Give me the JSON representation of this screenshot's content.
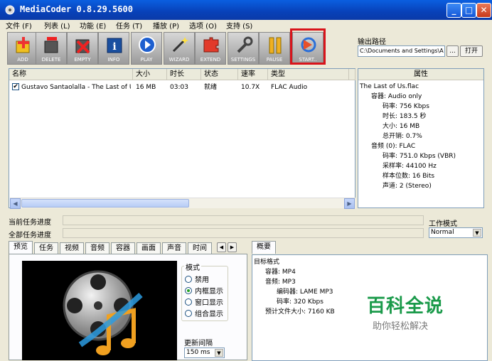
{
  "window": {
    "title": "MediaCoder 0.8.29.5600"
  },
  "menu": [
    {
      "label": "文件 (F)"
    },
    {
      "label": "列表 (L)"
    },
    {
      "label": "功能 (E)"
    },
    {
      "label": "任务 (T)"
    },
    {
      "label": "播放 (P)"
    },
    {
      "label": "选项 (O)"
    },
    {
      "label": "支持 (S)"
    }
  ],
  "toolbar": {
    "buttons": [
      {
        "label": "ADD",
        "icon": "add-icon"
      },
      {
        "label": "DELETE",
        "icon": "delete-icon"
      },
      {
        "label": "EMPTY",
        "icon": "empty-icon"
      },
      {
        "label": "INFO",
        "icon": "info-icon"
      },
      {
        "label": "PLAY",
        "icon": "play-icon"
      },
      {
        "label": "WIZARD",
        "icon": "wizard-icon"
      },
      {
        "label": "EXTEND",
        "icon": "extend-icon"
      },
      {
        "label": "SETTINGS",
        "icon": "settings-icon"
      },
      {
        "label": "PAUSE",
        "icon": "pause-icon"
      },
      {
        "label": "START..",
        "icon": "start-icon"
      }
    ],
    "highlight_color": "#d8141b"
  },
  "output": {
    "label": "输出路径",
    "path": "C:\\Documents and Settings\\A",
    "browse_label": "...",
    "open_label": "打开"
  },
  "file_list": {
    "columns": [
      "名称",
      "大小",
      "时长",
      "状态",
      "速率",
      "类型"
    ],
    "rows": [
      {
        "checked": true,
        "name": "Gustavo Santaolalla - The Last of Us",
        "size": "16 MB",
        "duration": "03:03",
        "status": "就绪",
        "speed": "10.7X",
        "type": "FLAC Audio"
      }
    ]
  },
  "properties": {
    "header": "属性",
    "lines": [
      "The Last of Us.flac",
      "容器: Audio only",
      "码率: 756 Kbps",
      "时长: 183.5 秒",
      "大小: 16 MB",
      "总开销: 0.7%",
      "音频 (0): FLAC",
      "码率: 751.0 Kbps (VBR)",
      "采样率: 44100 Hz",
      "样本位数: 16 Bits",
      "声道: 2 (Stereo)"
    ]
  },
  "progress": {
    "current_label": "当前任务进度",
    "total_label": "全部任务进度",
    "work_mode_label": "工作模式",
    "work_mode_value": "Normal"
  },
  "tabs": [
    "预览",
    "任务",
    "视频",
    "音频",
    "容器",
    "画面",
    "声音",
    "时间"
  ],
  "preview": {
    "mode_label": "模式",
    "modes": [
      {
        "label": "禁用",
        "selected": false
      },
      {
        "label": "内框显示",
        "selected": true
      },
      {
        "label": "窗口显示",
        "selected": false
      },
      {
        "label": "组合显示",
        "selected": false
      }
    ],
    "interval_label": "更新间隔",
    "interval_value": "150 ms"
  },
  "summary": {
    "tab_label": "概要",
    "lines": [
      "目标格式",
      "容器: MP4",
      "音频: MP3",
      "编码器: LAME MP3",
      "码率: 320 Kbps",
      "预计文件大小: 7160 KB"
    ]
  },
  "watermark": {
    "title": "百科全说",
    "subtitle": "助你轻松解决"
  }
}
